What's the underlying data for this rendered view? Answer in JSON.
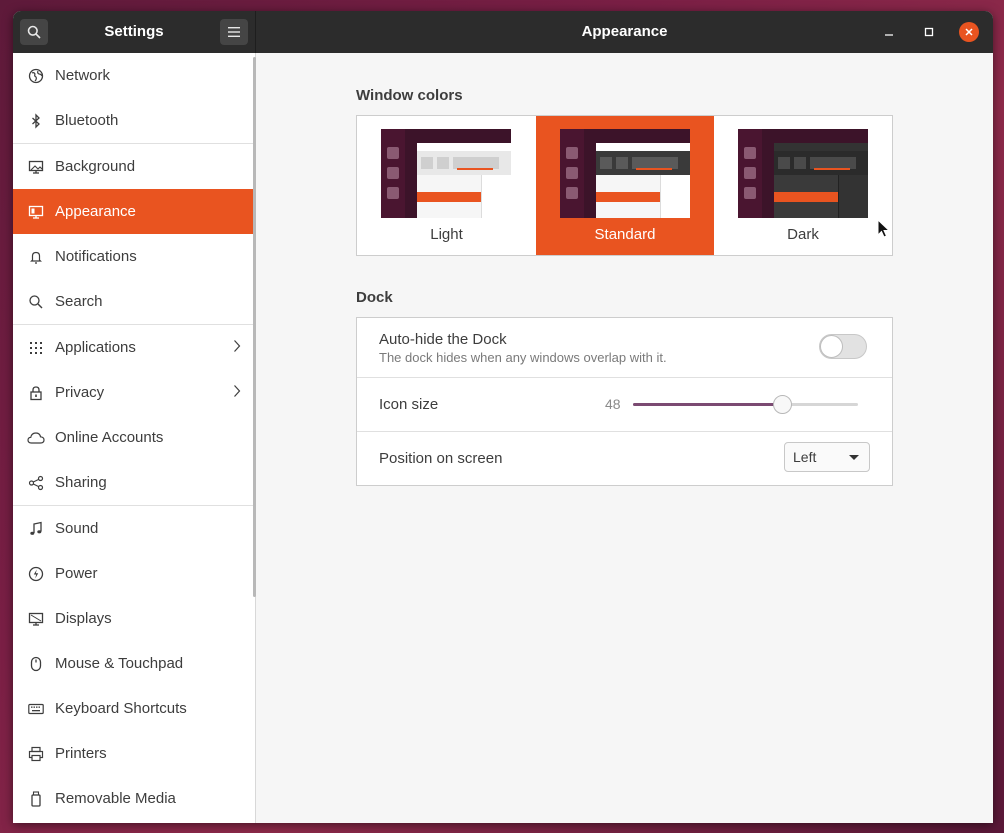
{
  "titlebar": {
    "settings_title": "Settings",
    "page_title": "Appearance",
    "close_color": "#e95420"
  },
  "sidebar": {
    "items": [
      {
        "label": "Network",
        "icon": "network-icon"
      },
      {
        "label": "Bluetooth",
        "icon": "bluetooth-icon"
      },
      {
        "label": "Background",
        "icon": "background-icon"
      },
      {
        "label": "Appearance",
        "icon": "appearance-icon",
        "active": true
      },
      {
        "label": "Notifications",
        "icon": "bell-icon"
      },
      {
        "label": "Search",
        "icon": "search-icon"
      },
      {
        "label": "Applications",
        "icon": "apps-grid-icon",
        "has_chevron": true
      },
      {
        "label": "Privacy",
        "icon": "lock-icon",
        "has_chevron": true
      },
      {
        "label": "Online Accounts",
        "icon": "cloud-icon"
      },
      {
        "label": "Sharing",
        "icon": "share-icon"
      },
      {
        "label": "Sound",
        "icon": "music-note-icon"
      },
      {
        "label": "Power",
        "icon": "power-icon"
      },
      {
        "label": "Displays",
        "icon": "display-icon"
      },
      {
        "label": "Mouse & Touchpad",
        "icon": "mouse-icon"
      },
      {
        "label": "Keyboard Shortcuts",
        "icon": "keyboard-icon"
      },
      {
        "label": "Printers",
        "icon": "printer-icon"
      },
      {
        "label": "Removable Media",
        "icon": "usb-drive-icon"
      }
    ]
  },
  "window_colors": {
    "title": "Window colors",
    "options": [
      {
        "label": "Light"
      },
      {
        "label": "Standard",
        "selected": true
      },
      {
        "label": "Dark"
      }
    ],
    "accent": "#e95420"
  },
  "dock": {
    "title": "Dock",
    "autohide": {
      "title": "Auto-hide the Dock",
      "subtitle": "The dock hides when any windows overlap with it.",
      "enabled": false
    },
    "icon_size": {
      "title": "Icon size",
      "value": "48",
      "fraction": 0.66
    },
    "position": {
      "title": "Position on screen",
      "value": "Left"
    }
  }
}
